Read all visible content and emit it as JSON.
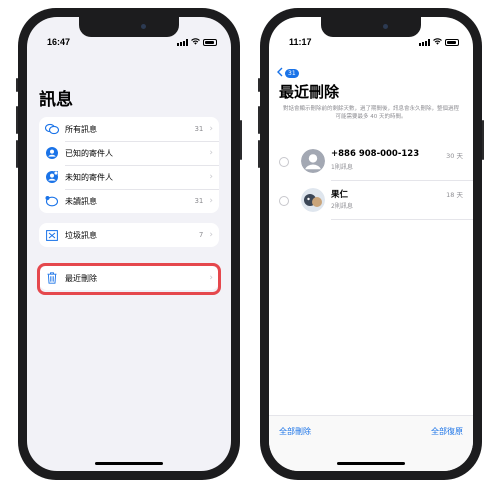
{
  "left_phone": {
    "time": "16:47",
    "title": "訊息",
    "filters": [
      {
        "label": "所有訊息",
        "count": "31",
        "icon": "chat-bubbles-icon"
      },
      {
        "label": "已知的寄件人",
        "count": "",
        "icon": "person-circle-icon"
      },
      {
        "label": "未知的寄件人",
        "count": "",
        "icon": "person-question-icon"
      },
      {
        "label": "未讀訊息",
        "count": "31",
        "icon": "unread-bubble-icon"
      }
    ],
    "junk": {
      "label": "垃圾訊息",
      "count": "7",
      "icon": "junk-bin-icon"
    },
    "recently_deleted": {
      "label": "最近刪除",
      "icon": "trash-icon"
    },
    "highlight_color": "#e5484d"
  },
  "right_phone": {
    "time": "11:17",
    "back_badge": "31",
    "title": "最近刪除",
    "description": "對話會顯示刪除前的剩餘天數，過了期間後，訊息會永久刪除，整個過程可能需要最多 40 天的時間。",
    "messages": [
      {
        "name": "+886 908-000-123",
        "sub": "1則訊息",
        "time": "30 天"
      },
      {
        "name": "果仁",
        "sub": "2則訊息",
        "time": "18 天"
      }
    ],
    "delete_all": "全部刪除",
    "restore_all": "全部復原"
  },
  "colors": {
    "accent": "#1a73e8",
    "background": "#f2f2f7"
  }
}
